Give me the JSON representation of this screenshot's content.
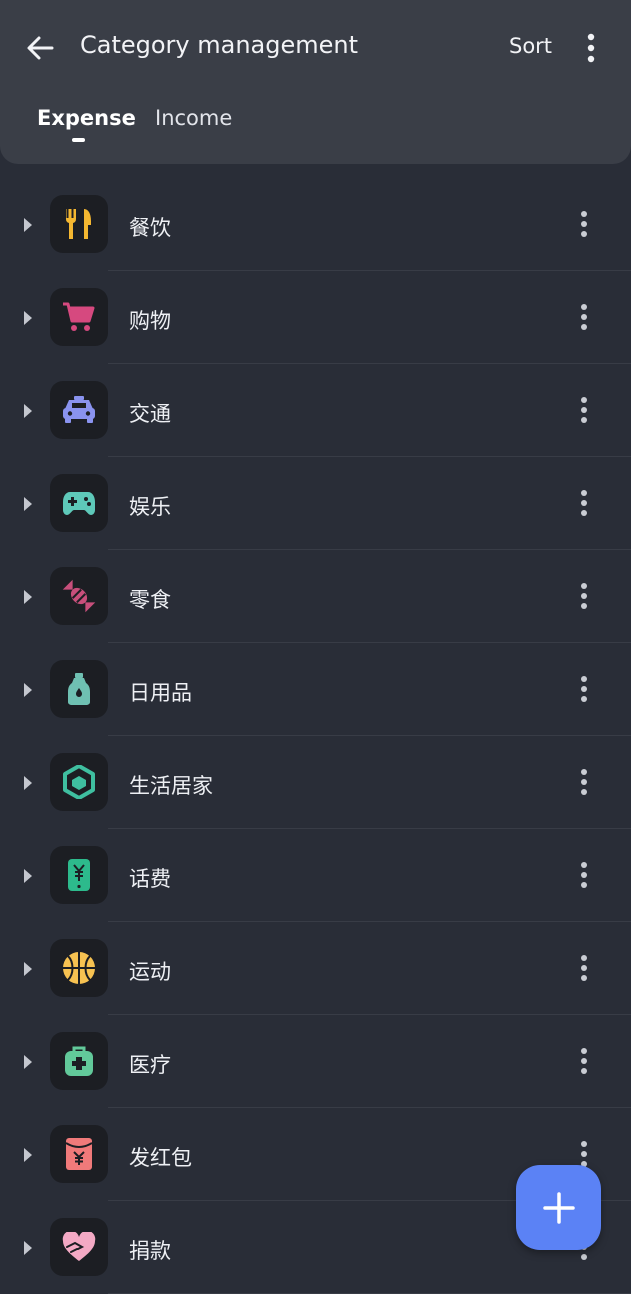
{
  "header": {
    "title": "Category management",
    "sort_label": "Sort",
    "tabs": [
      {
        "label": "Expense",
        "selected": true
      },
      {
        "label": "Income",
        "selected": false
      }
    ]
  },
  "categories": [
    {
      "label": "餐饮",
      "icon": "utensils-icon",
      "color": "#f4b731"
    },
    {
      "label": "购物",
      "icon": "shopping-cart-icon",
      "color": "#d6497f"
    },
    {
      "label": "交通",
      "icon": "taxi-icon",
      "color": "#8a93ef"
    },
    {
      "label": "娱乐",
      "icon": "gamepad-icon",
      "color": "#5ec9b9"
    },
    {
      "label": "零食",
      "icon": "candy-icon",
      "color": "#c84f7b"
    },
    {
      "label": "日用品",
      "icon": "detergent-bottle-icon",
      "color": "#6fc0b2"
    },
    {
      "label": "生活居家",
      "icon": "home-cube-icon",
      "color": "#3fbfa0"
    },
    {
      "label": "话费",
      "icon": "phone-bill-icon",
      "color": "#2dba8c"
    },
    {
      "label": "运动",
      "icon": "basketball-icon",
      "color": "#f7c251"
    },
    {
      "label": "医疗",
      "icon": "medical-kit-icon",
      "color": "#62c99a"
    },
    {
      "label": "发红包",
      "icon": "red-envelope-icon",
      "color": "#f07a7a"
    },
    {
      "label": "捐款",
      "icon": "donation-heart-icon",
      "color": "#f3a9c4"
    }
  ],
  "fab": {
    "icon": "plus-icon",
    "color": "#5b82f5"
  }
}
